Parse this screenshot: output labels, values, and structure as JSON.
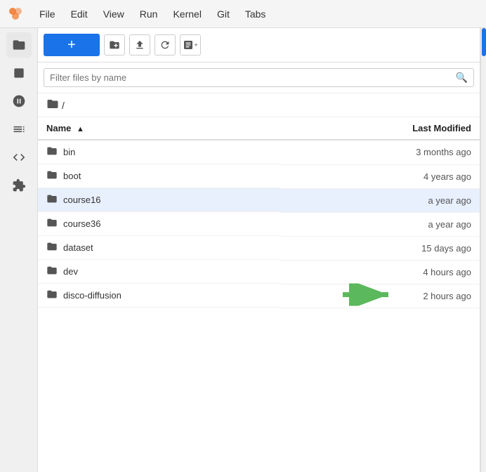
{
  "menubar": {
    "items": [
      "File",
      "Edit",
      "View",
      "Run",
      "Kernel",
      "Git",
      "Tabs"
    ]
  },
  "toolbar": {
    "new_label": "+",
    "icons": [
      "folder-new",
      "upload",
      "refresh",
      "git-add"
    ]
  },
  "search": {
    "placeholder": "Filter files by name"
  },
  "breadcrumb": {
    "path": "/"
  },
  "table": {
    "col_name": "Name",
    "col_modified": "Last Modified",
    "rows": [
      {
        "name": "bin",
        "modified": "3 months ago",
        "selected": false,
        "arrow": false
      },
      {
        "name": "boot",
        "modified": "4 years ago",
        "selected": false,
        "arrow": false
      },
      {
        "name": "course16",
        "modified": "a year ago",
        "selected": true,
        "arrow": false
      },
      {
        "name": "course36",
        "modified": "a year ago",
        "selected": false,
        "arrow": false
      },
      {
        "name": "dataset",
        "modified": "15 days ago",
        "selected": false,
        "arrow": false
      },
      {
        "name": "dev",
        "modified": "4 hours ago",
        "selected": false,
        "arrow": false
      },
      {
        "name": "disco-diffusion",
        "modified": "2 hours ago",
        "selected": false,
        "arrow": true
      }
    ]
  },
  "sidebar": {
    "icons": [
      {
        "name": "folder-icon",
        "symbol": "📁",
        "active": true
      },
      {
        "name": "stop-icon",
        "symbol": "■",
        "active": false
      },
      {
        "name": "git-icon",
        "symbol": "◆",
        "active": false
      },
      {
        "name": "list-icon",
        "symbol": "≡",
        "active": false
      },
      {
        "name": "code-icon",
        "symbol": "</>",
        "active": false
      },
      {
        "name": "puzzle-icon",
        "symbol": "⬛",
        "active": false
      }
    ]
  }
}
